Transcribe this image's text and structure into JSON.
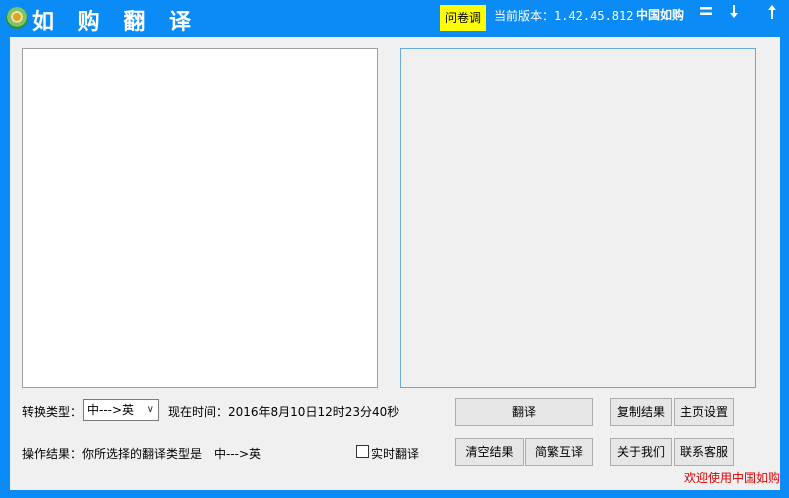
{
  "titlebar": {
    "title": "如 购 翻 译",
    "survey_label": "问卷调查",
    "version": "当前版本：1.42.45.812",
    "brand": "中国如购",
    "menu_icon": "menu-icon",
    "minimize_icon": "minimize-arrow-icon",
    "close_icon": "upload-arrow-icon"
  },
  "options": {
    "type_label": "转换类型：",
    "type_value": "中--->英",
    "time_label": "现在时间：2016年8月10日12时23分40秒"
  },
  "status": {
    "result_label": "操作结果：你所选择的翻译类型是　中--->英",
    "realtime_label": "实时翻译",
    "welcome": "欢迎使用中国如购翻"
  },
  "buttons": {
    "translate": "翻译",
    "clear": "清空结果",
    "convert": "简繁互译",
    "copy": "复制结果",
    "home": "主页设置",
    "about": "关于我们",
    "support": "联系客服"
  },
  "colors": {
    "frame": "#0a8bf5",
    "survey_bg": "#ffff00",
    "welcome": "#e00000"
  }
}
